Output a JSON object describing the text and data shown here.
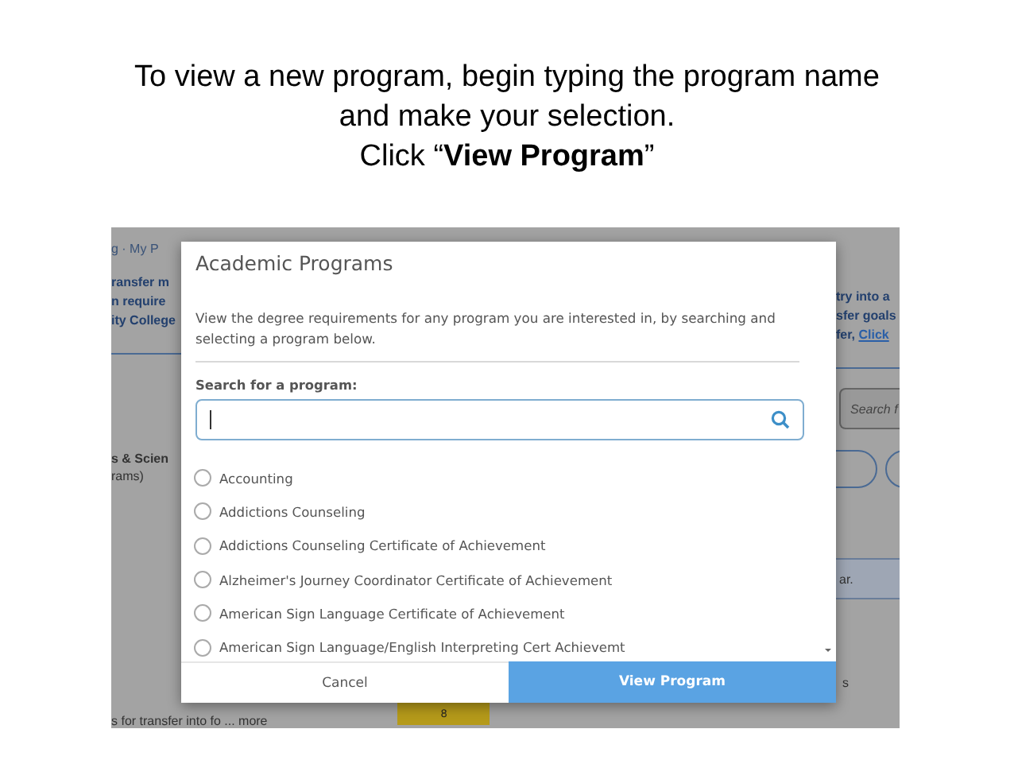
{
  "slide_title": {
    "lines": [
      "To view a new program, begin typing the program name",
      "and make your selection.",
      "Click “**View Program**”"
    ]
  },
  "background": {
    "left_nav": "g · My P",
    "left_links": [
      "ransfer m",
      "n require",
      "ity College"
    ],
    "left_heading": "s & Scien",
    "left_subtext": "rams)",
    "right_texts": [
      "try into a",
      "sfer goals",
      "fer,"
    ],
    "right_link": "Click",
    "search_placeholder": "Search f",
    "row_text": "ar.",
    "row_text_2": "s",
    "bottom_text": "s for transfer into fo ... more",
    "badge": "8"
  },
  "dialog": {
    "title": "Academic Programs",
    "description": "View the degree requirements for any program you are interested in, by searching and selecting a program below.",
    "search_label": "Search for a program:",
    "programs": [
      {
        "label": "Accounting",
        "selected": false
      },
      {
        "label": "Addictions Counseling",
        "selected": false
      },
      {
        "label": "Addictions Counseling Certificate of Achievement",
        "selected": false
      },
      {
        "label": "Alzheimer's Journey Coordinator Certificate of Achievement",
        "selected": false
      },
      {
        "label": "American Sign Language Certificate of Achievement",
        "selected": false
      },
      {
        "label": "American Sign Language/English Interpreting Cert Achievemt",
        "selected": false
      }
    ],
    "buttons": [
      {
        "label": "Cancel",
        "kind": "secondary"
      },
      {
        "label": "View Program",
        "kind": "primary"
      }
    ]
  }
}
